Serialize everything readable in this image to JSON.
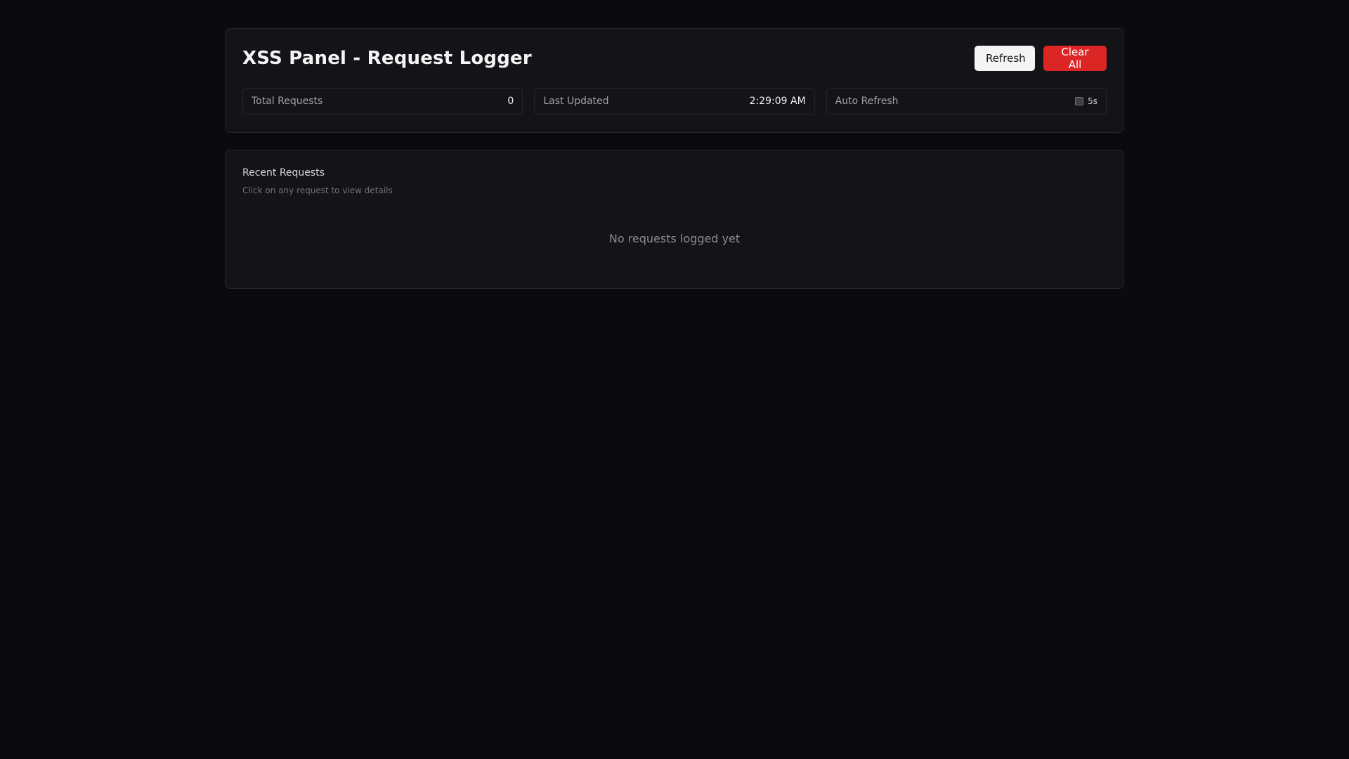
{
  "header": {
    "title": "XSS Panel - Request Logger",
    "refresh_label": "Refresh",
    "clear_label": "Clear All"
  },
  "stats": {
    "total_label": "Total Requests",
    "total_value": "0",
    "updated_label": "Last Updated",
    "updated_value": "2:29:09 AM",
    "auto_label": "Auto Refresh",
    "auto_interval": "5s",
    "auto_enabled": false
  },
  "requests": {
    "title": "Recent Requests",
    "subtitle": "Click on any request to view details",
    "empty_message": "No requests logged yet"
  },
  "colors": {
    "background": "#0b0b0f",
    "card": "#131318",
    "danger": "#dc2626"
  }
}
